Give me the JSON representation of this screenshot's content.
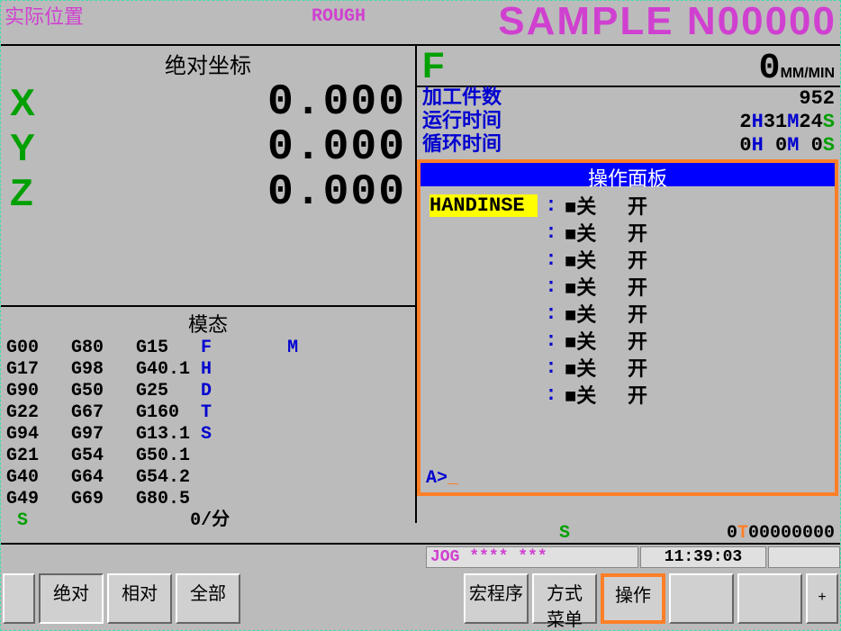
{
  "header": {
    "title_label": "实际位置",
    "rough": "ROUGH",
    "sample": "SAMPLE N00000"
  },
  "abs_coords": {
    "title": "绝对坐标",
    "rows": [
      {
        "axis": "X",
        "value": "0.000"
      },
      {
        "axis": "Y",
        "value": "0.000"
      },
      {
        "axis": "Z",
        "value": "0.000"
      }
    ]
  },
  "modal": {
    "title": "模态",
    "cols": {
      "c0": [
        "G00",
        "G17",
        "G90",
        "G22",
        "G94",
        "G21",
        "G40",
        "G49"
      ],
      "c1": [
        "G80",
        "G98",
        "G50",
        "G67",
        "G97",
        "G54",
        "G64",
        "G69"
      ],
      "c2": [
        "G15",
        "G40.1",
        "G25",
        "G160",
        "G13.1",
        "G50.1",
        "G54.2",
        "G80.5"
      ],
      "c3": [
        "F",
        "H",
        "D",
        "T",
        "S",
        "",
        "",
        ""
      ],
      "c4": [
        "M",
        "",
        "",
        "",
        "",
        "",
        "",
        ""
      ]
    },
    "spindle_s": "S",
    "spindle_unit": "0/分"
  },
  "feed": {
    "letter": "F",
    "value": "0",
    "unit": "MM/MIN"
  },
  "info": {
    "parts_label": "加工件数",
    "parts_value": "952",
    "run_label": "运行时间",
    "run_h": "2",
    "run_m": "31",
    "run_s": "24",
    "cycle_label": "循环时间",
    "cycle_h": "0",
    "cycle_m": "0",
    "cycle_s": "0"
  },
  "op_panel": {
    "title": "操作面板",
    "rows": [
      {
        "name": "HANDINSE",
        "off": "■关",
        "on": "开",
        "hl": true
      },
      {
        "name": "",
        "off": "■关",
        "on": "开"
      },
      {
        "name": "",
        "off": "■关",
        "on": "开"
      },
      {
        "name": "",
        "off": "■关",
        "on": "开"
      },
      {
        "name": "",
        "off": "■关",
        "on": "开"
      },
      {
        "name": "",
        "off": "■关",
        "on": "开"
      },
      {
        "name": "",
        "off": "■关",
        "on": "开"
      },
      {
        "name": "",
        "off": "■关",
        "on": "开"
      }
    ],
    "prompt_a": "A",
    "prompt_gt": ">",
    "prompt_cursor": "_"
  },
  "status": {
    "s": "S",
    "t": "0T00000000"
  },
  "jog": {
    "mode": "JOG",
    "stars": "**** ***",
    "time": "11:39:03"
  },
  "softkeys": {
    "left": [
      "绝对",
      "相对",
      "全部"
    ],
    "right": [
      "宏程序",
      "方式\n菜单",
      "操作"
    ],
    "plus": "+"
  }
}
